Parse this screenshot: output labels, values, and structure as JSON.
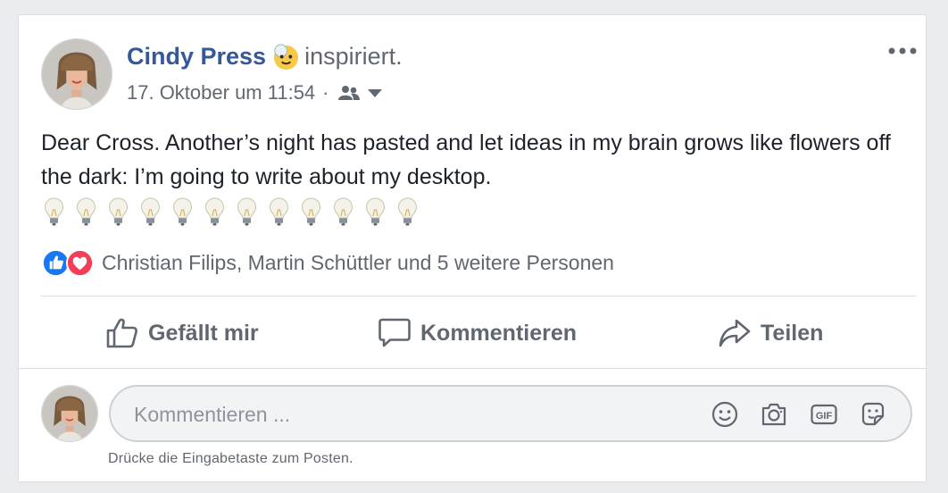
{
  "post": {
    "author": "Cindy Press",
    "feeling": "inspiriert.",
    "timestamp": "17. Oktober um 11:54",
    "meta_separator": "·",
    "audience_icon": "friends-icon",
    "text": "Dear Cross. Another’s night has pasted and let ideas in my brain grows like flowers off the dark: I’m going to write about my desktop.",
    "emoji_icon": "light-bulb-icon",
    "emoji_count": 12
  },
  "reactions": {
    "types": [
      "like-icon",
      "love-icon"
    ],
    "names": "Christian Filips, Martin Schüttler und 5 weitere Personen"
  },
  "actions": {
    "like": "Gefällt mir",
    "comment": "Kommentieren",
    "share": "Teilen"
  },
  "comment_box": {
    "placeholder": "Kommentieren ...",
    "value": "",
    "icons": [
      "smiley-icon",
      "camera-icon",
      "gif-icon",
      "sticker-icon"
    ],
    "hint": "Drücke die Eingabetaste zum Posten."
  },
  "colors": {
    "author": "#365899",
    "secondary_text": "#616770",
    "like_blue": "#1877f2",
    "love_red": "#f33e58"
  }
}
